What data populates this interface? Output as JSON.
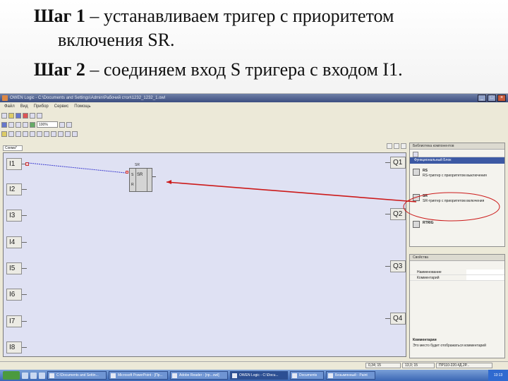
{
  "slide": {
    "step1_bold": "Шаг 1",
    "step1_rest": " – устанавливаем тригер с приоритетом",
    "step1_cont": "включения SR.",
    "step2_bold": "Шаг 2",
    "step2_rest": " – соединяем вход S тригера с входом I1."
  },
  "window": {
    "title": "OWEN Logic - C:\\Documents and Settings\\Admin\\Рабочий стол\\1232_1232_1.owl",
    "menu": [
      "Файл",
      "Вид",
      "Прибор",
      "Сервис",
      "Помощь"
    ],
    "zoom": "100%"
  },
  "canvas": {
    "tab": "Схема*",
    "inputs": [
      "I1",
      "I2",
      "I3",
      "I4",
      "I5",
      "I6",
      "I7",
      "I8"
    ],
    "outputs": [
      "Q1",
      "Q2",
      "Q3",
      "Q4"
    ],
    "sr_block": {
      "tag": "SR",
      "name": "SR",
      "s": "S",
      "r": "R"
    }
  },
  "library": {
    "title": "Библиотека компонентов",
    "category": "Функциональный Блок",
    "items": [
      {
        "name": "RS",
        "desc": "RS-триггер с приоритетом выключения"
      },
      {
        "name": "SR",
        "desc": "SR-триггер с приоритетом включения"
      },
      {
        "name": "RTRIG",
        "desc": ""
      }
    ]
  },
  "properties": {
    "title": "Свойства",
    "rows": [
      {
        "key": "Наименование",
        "value": ""
      },
      {
        "key": "Комментарий",
        "value": ""
      }
    ],
    "comment_title": "Комментарии",
    "comment_text": "Это место будет отображаться комментарий"
  },
  "statusbar": [
    "0,34; 15",
    "13,0; 15",
    "ПР110-220.4Д.2Р..."
  ],
  "taskbar": {
    "items": [
      "C:\\Documents and Settin...",
      "Microsoft PowerPoint - [Пр...",
      "Adobe Reader - [пр...owl]",
      "OWEN Logic - C:\\Docu...",
      "Documents",
      "Безымянный - Paint"
    ],
    "active_index": 3,
    "clock": "13:13"
  },
  "colors": {
    "annotation_red": "#cc1a1a",
    "wire_blue": "#3a3ad0",
    "canvas_bg": "#dfe1f3"
  }
}
